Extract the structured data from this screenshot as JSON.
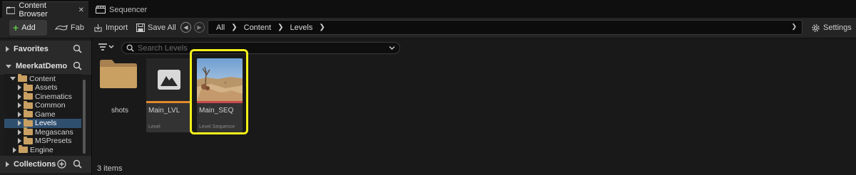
{
  "tabs": [
    {
      "label": "Content Browser",
      "icon": "folder-tab-icon",
      "close": "✕"
    },
    {
      "label": "Sequencer",
      "icon": "clapperboard-icon"
    }
  ],
  "toolbar": {
    "add_label": "Add",
    "fab_label": "Fab",
    "import_label": "Import",
    "save_all_label": "Save All",
    "settings_label": "Settings"
  },
  "breadcrumb": [
    "All",
    "Content",
    "Levels"
  ],
  "sidebar": {
    "favorites_label": "Favorites",
    "project_label": "MeerkatDemo",
    "collections_label": "Collections",
    "tree": [
      {
        "label": "Content",
        "depth": 0,
        "expanded": true
      },
      {
        "label": "Assets",
        "depth": 1
      },
      {
        "label": "Cinematics",
        "depth": 1
      },
      {
        "label": "Common",
        "depth": 1
      },
      {
        "label": "Game",
        "depth": 1
      },
      {
        "label": "Levels",
        "depth": 1,
        "selected": true
      },
      {
        "label": "Megascans",
        "depth": 1
      },
      {
        "label": "MSPresets",
        "depth": 1
      },
      {
        "label": "Engine",
        "depth": 0
      }
    ]
  },
  "search": {
    "placeholder": "Search Levels"
  },
  "assets": [
    {
      "name": "shots",
      "kind": "folder"
    },
    {
      "name": "Main_LVL",
      "type": "Level",
      "bar_color": "#e0892e"
    },
    {
      "name": "Main_SEQ",
      "type": "Level Sequence",
      "bar_color": "#c94a4a"
    }
  ],
  "status": {
    "count_label": "3 items"
  },
  "colors": {
    "accent_green": "#5fc24b",
    "highlight": "#f4f01a",
    "folder": "#c9a062",
    "selection": "#2f4f6e"
  }
}
